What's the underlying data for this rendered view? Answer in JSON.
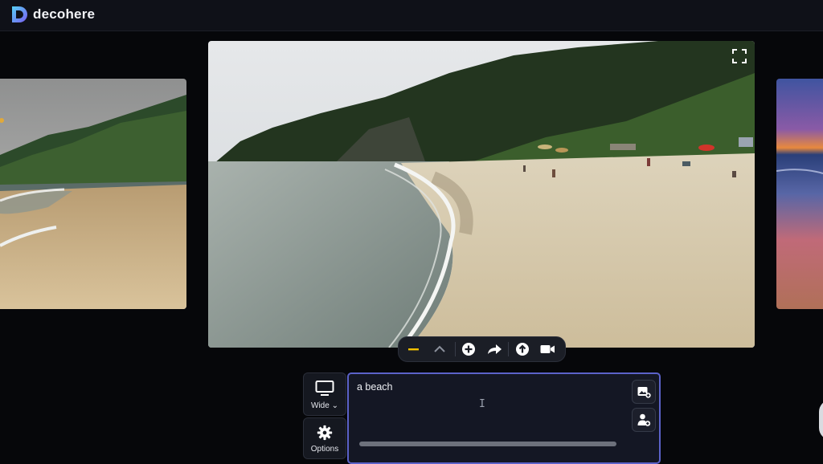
{
  "app": {
    "name": "decohere",
    "accent": "#5b62c9",
    "logo_color": "#6d7cf6"
  },
  "gallery": {
    "left_image": "beach-left-thumbnail",
    "main_image": "beach-main-image",
    "right_image": "sunset-right-thumbnail",
    "expand_icon": "expand-icon"
  },
  "toolbar": {
    "buttons": [
      "minus-icon",
      "chevron-up-icon",
      "add-circle-icon",
      "share-icon",
      "upload-icon",
      "video-icon"
    ],
    "active_color": "#f2c200"
  },
  "prompt": {
    "value": "a beach"
  },
  "aspect": {
    "label": "Wide",
    "icon": "monitor-icon"
  },
  "options": {
    "label": "Options",
    "icon": "gear-icon"
  },
  "prompt_actions": [
    "add-image-icon",
    "add-person-icon"
  ]
}
